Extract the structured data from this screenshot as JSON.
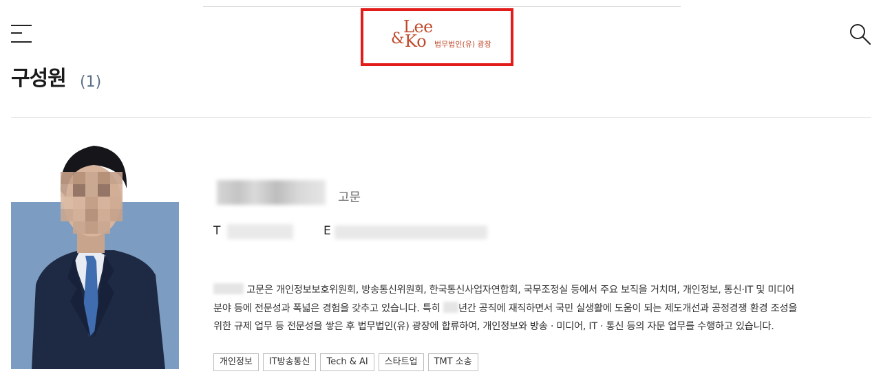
{
  "header": {
    "logo": {
      "text_top": "Lee",
      "text_amp": "&",
      "text_bottom": "Ko",
      "firm_name": "법무법인(유) 광장"
    },
    "menu_icon": "hamburger-menu-icon",
    "search_icon": "search-icon"
  },
  "page": {
    "title": "구성원",
    "count_open": "(",
    "count": "1",
    "count_close": ")"
  },
  "member": {
    "role": "고문",
    "tel_label": "T",
    "email_label": "E",
    "bio_lines": [
      {
        "a": "고문은 개인정보보호위원회, 방송통신위원회, 한국통신사업자연합회, 국무조정실 등에서 주요 보직을 거치며, 개인정보, 통신·IT 및 미디어"
      },
      {
        "a": "분야 등에 전문성과 폭넓은 경험을 갖추고 있습니다. 특히",
        "b": "년간 공직에 재직하면서 국민 실생활에 도움이 되는 제도개선과 공정경쟁 환경 조성을"
      },
      {
        "a": "위한 규제 업무 등 전문성을 쌓은 후 법무법인(유) 광장에 합류하여, 개인정보와 방송 · 미디어, IT · 통신 등의 자문 업무를 수행하고 있습니다."
      }
    ],
    "tags": [
      "개인정보",
      "IT방송통신",
      "Tech & AI",
      "스타트업",
      "TMT 소송"
    ]
  },
  "colors": {
    "brand": "#c0492b",
    "highlight_box": "#e21b1b",
    "photo_background": "#7c9dc1",
    "count_text": "#5a6f85"
  }
}
